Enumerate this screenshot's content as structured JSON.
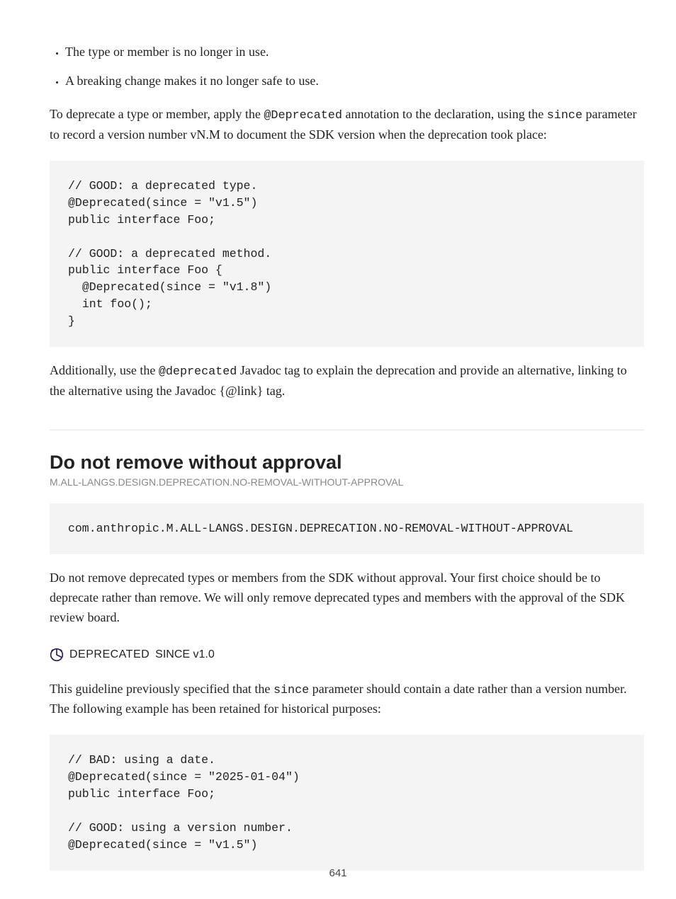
{
  "bullets": [
    "The type or member is no longer in use.",
    "A breaking change makes it no longer safe to use."
  ],
  "para1_prefix": "To deprecate a type or member, apply the ",
  "para1_code": "@Deprecated",
  "para1_mid": " annotation to the declaration, using the ",
  "para1_code2": "since",
  "para1_suffix": " parameter to record a version number vN.M to document the SDK version when the deprecation took place:",
  "code1_lines": [
    "// GOOD: a deprecated type.",
    "@Deprecated(since = \"v1.5\")",
    "public interface Foo;",
    "",
    "// GOOD: a deprecated method.",
    "public interface Foo {",
    "  @Deprecated(since = \"v1.8\")",
    "  int foo();",
    "}"
  ],
  "para2_prefix": "Additionally, use the ",
  "para2_code": "@deprecated",
  "para2_suffix": " Javadoc tag to explain the deprecation and provide an alternative, linking to the alternative using the Javadoc {@link} tag.",
  "panel_title": "Do not remove without approval",
  "panel_breadcrumb": "M.ALL-LANGS.DESIGN.DEPRECATION.NO-REMOVAL-WITHOUT-APPROVAL",
  "code2": "com.anthropic.M.ALL-LANGS.DESIGN.DEPRECATION.NO-REMOVAL-WITHOUT-APPROVAL",
  "para3": "Do not remove deprecated types or members from the SDK without approval. Your first choice should be to deprecate rather than remove. We will only remove deprecated types and members with the approval of the SDK review board.",
  "deprecated_label": "DEPRECATED",
  "deprecated_since": "SINCE v1.0",
  "para4_prefix": "This guideline previously specified that the ",
  "para4_code": "since",
  "para4_suffix": " parameter should contain a date rather than a version number. The following example has been retained for historical purposes:",
  "code3_lines": [
    "// BAD: using a date.",
    "@Deprecated(since = \"2025-01-04\")",
    "public interface Foo;",
    "",
    "// GOOD: using a version number.",
    "@Deprecated(since = \"v1.5\")"
  ],
  "page_number": "641"
}
